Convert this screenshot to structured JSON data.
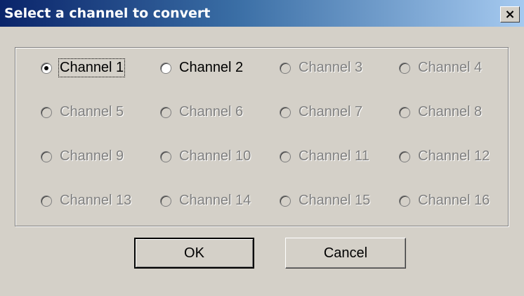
{
  "dialog": {
    "title": "Select a channel to convert",
    "close_label": "×"
  },
  "channels": [
    {
      "label": "Channel 1",
      "checked": true,
      "enabled": true,
      "focused": true
    },
    {
      "label": "Channel 2",
      "checked": false,
      "enabled": true
    },
    {
      "label": "Channel 3",
      "checked": false,
      "enabled": false
    },
    {
      "label": "Channel 4",
      "checked": false,
      "enabled": false
    },
    {
      "label": "Channel 5",
      "checked": false,
      "enabled": false
    },
    {
      "label": "Channel 6",
      "checked": false,
      "enabled": false
    },
    {
      "label": "Channel 7",
      "checked": false,
      "enabled": false
    },
    {
      "label": "Channel 8",
      "checked": false,
      "enabled": false
    },
    {
      "label": "Channel 9",
      "checked": false,
      "enabled": false
    },
    {
      "label": "Channel 10",
      "checked": false,
      "enabled": false
    },
    {
      "label": "Channel 11",
      "checked": false,
      "enabled": false
    },
    {
      "label": "Channel 12",
      "checked": false,
      "enabled": false
    },
    {
      "label": "Channel 13",
      "checked": false,
      "enabled": false
    },
    {
      "label": "Channel 14",
      "checked": false,
      "enabled": false
    },
    {
      "label": "Channel 15",
      "checked": false,
      "enabled": false
    },
    {
      "label": "Channel 16",
      "checked": false,
      "enabled": false
    }
  ],
  "buttons": {
    "ok_label": "OK",
    "cancel_label": "Cancel"
  }
}
